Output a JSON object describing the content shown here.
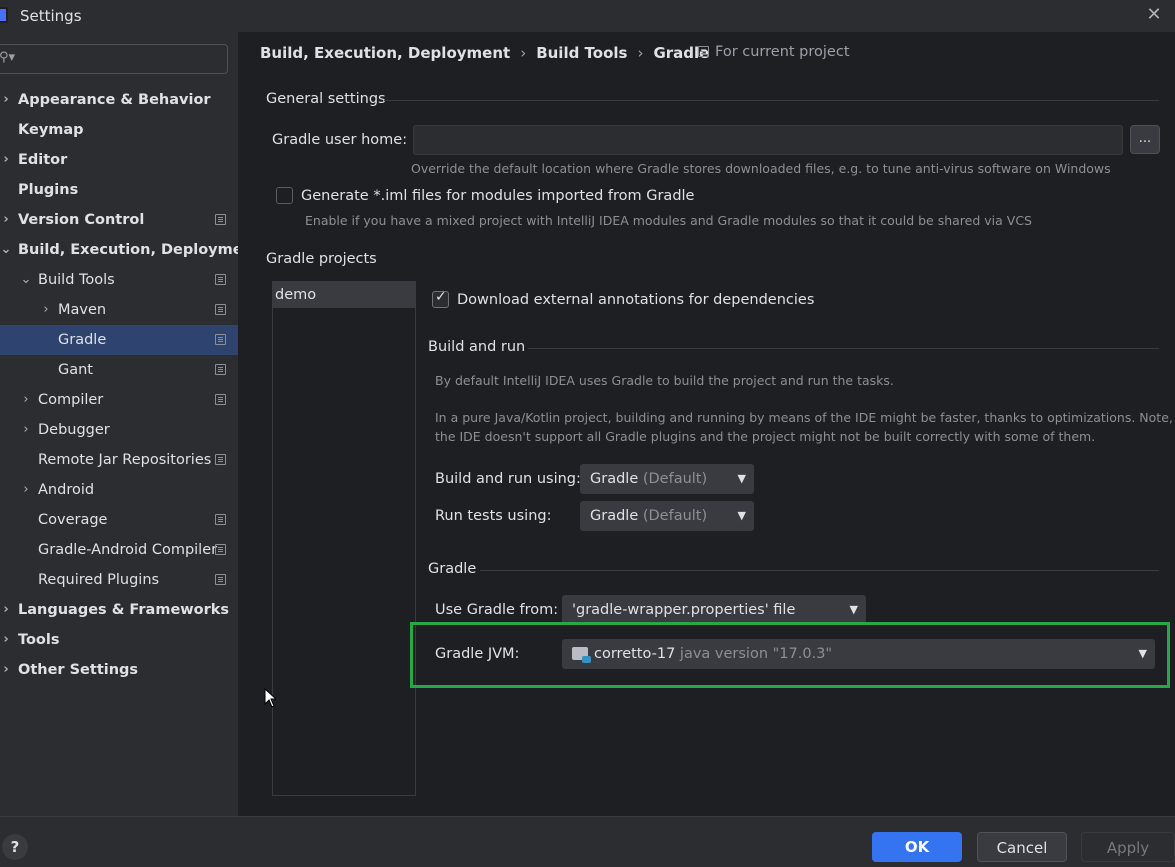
{
  "window": {
    "title": "Settings",
    "close_glyph": "✕"
  },
  "sidebar": {
    "search_glyph": "⚲▾",
    "items": [
      {
        "label": "Appearance & Behavior",
        "bold": true,
        "chevron": "›",
        "level": 0,
        "icon": false
      },
      {
        "label": "Keymap",
        "bold": true,
        "chevron": "",
        "level": 0,
        "icon": false
      },
      {
        "label": "Editor",
        "bold": true,
        "chevron": "›",
        "level": 0,
        "icon": false
      },
      {
        "label": "Plugins",
        "bold": true,
        "chevron": "",
        "level": 0,
        "icon": false
      },
      {
        "label": "Version Control",
        "bold": true,
        "chevron": "›",
        "level": 0,
        "icon": true
      },
      {
        "label": "Build, Execution, Deployment",
        "bold": true,
        "chevron": "⌄",
        "level": 0,
        "icon": false
      },
      {
        "label": "Build Tools",
        "bold": false,
        "chevron": "⌄",
        "level": 1,
        "icon": true
      },
      {
        "label": "Maven",
        "bold": false,
        "chevron": "›",
        "level": 2,
        "icon": true
      },
      {
        "label": "Gradle",
        "bold": false,
        "chevron": "",
        "level": 2,
        "icon": true,
        "selected": true
      },
      {
        "label": "Gant",
        "bold": false,
        "chevron": "",
        "level": 2,
        "icon": true
      },
      {
        "label": "Compiler",
        "bold": false,
        "chevron": "›",
        "level": 1,
        "icon": true
      },
      {
        "label": "Debugger",
        "bold": false,
        "chevron": "›",
        "level": 1,
        "icon": false
      },
      {
        "label": "Remote Jar Repositories",
        "bold": false,
        "chevron": "",
        "level": 1,
        "icon": true
      },
      {
        "label": "Android",
        "bold": false,
        "chevron": "›",
        "level": 1,
        "icon": false
      },
      {
        "label": "Coverage",
        "bold": false,
        "chevron": "",
        "level": 1,
        "icon": true
      },
      {
        "label": "Gradle-Android Compiler",
        "bold": false,
        "chevron": "",
        "level": 1,
        "icon": true
      },
      {
        "label": "Required Plugins",
        "bold": false,
        "chevron": "",
        "level": 1,
        "icon": true
      },
      {
        "label": "Languages & Frameworks",
        "bold": true,
        "chevron": "›",
        "level": 0,
        "icon": false
      },
      {
        "label": "Tools",
        "bold": true,
        "chevron": "›",
        "level": 0,
        "icon": false
      },
      {
        "label": "Other Settings",
        "bold": true,
        "chevron": "›",
        "level": 0,
        "icon": false
      }
    ]
  },
  "breadcrumb": {
    "part1": "Build, Execution, Deployment",
    "part2": "Build Tools",
    "part3": "Gradle",
    "separator": "›",
    "scope": "For current project"
  },
  "general": {
    "section_title": "General settings",
    "user_home_label": "Gradle user home:",
    "browse_label": "...",
    "user_home_hint": "Override the default location where Gradle stores downloaded files, e.g. to tune anti-virus software on Windows",
    "iml_label": "Generate *.iml files for modules imported from Gradle",
    "iml_hint": "Enable if you have a mixed project with IntelliJ IDEA modules and Gradle modules so that it could be shared via VCS"
  },
  "projects": {
    "section_title": "Gradle projects",
    "items": [
      "demo"
    ],
    "download_annotations_label": "Download external annotations for dependencies",
    "checkmark": "✓"
  },
  "build_run": {
    "section_title": "Build and run",
    "desc1": "By default IntelliJ IDEA uses Gradle to build the project and run the tasks.",
    "desc2_line1": "In a pure Java/Kotlin project, building and running by means of the IDE might be faster, thanks to optimizations. Note, that",
    "desc2_line2": "the IDE doesn't support all Gradle plugins and the project might not be built correctly with some of them.",
    "build_using_label": "Build and run using:",
    "build_using_value": "Gradle",
    "build_using_suffix": "(Default)",
    "tests_using_label": "Run tests using:",
    "tests_using_value": "Gradle",
    "tests_using_suffix": "(Default)"
  },
  "gradle": {
    "section_title": "Gradle",
    "use_from_label": "Use Gradle from:",
    "use_from_value": "'gradle-wrapper.properties' file",
    "jvm_label": "Gradle JVM:",
    "jvm_value": "corretto-17",
    "jvm_version": "java version \"17.0.3\""
  },
  "footer": {
    "help": "?",
    "ok": "OK",
    "cancel": "Cancel",
    "apply": "Apply"
  },
  "colors": {
    "accent": "#3574f0",
    "selection": "#2e436e",
    "highlight": "#27a844"
  }
}
